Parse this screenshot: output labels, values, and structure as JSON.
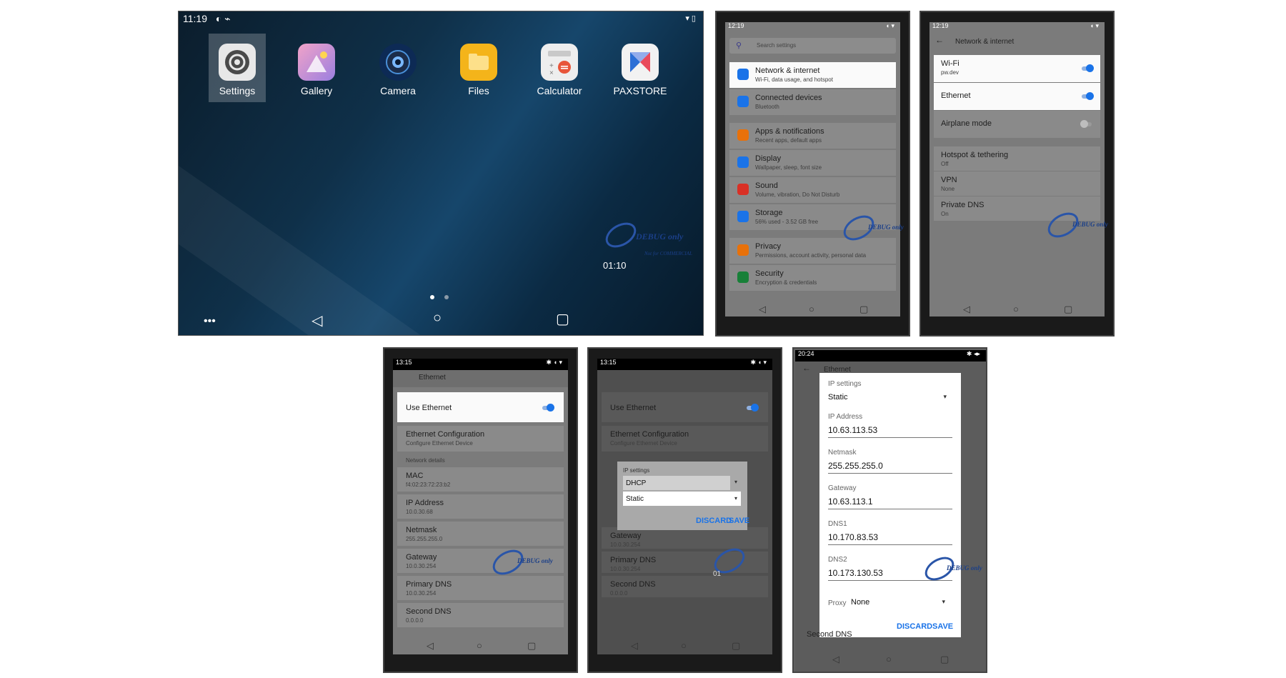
{
  "home": {
    "clock": "11:19",
    "apps": [
      {
        "label": "Settings",
        "icon": "settings-icon"
      },
      {
        "label": "Gallery",
        "icon": "gallery-icon"
      },
      {
        "label": "Camera",
        "icon": "camera-icon"
      },
      {
        "label": "Files",
        "icon": "files-icon"
      },
      {
        "label": "Calculator",
        "icon": "calculator-icon"
      },
      {
        "label": "PAXSTORE",
        "icon": "paxstore-icon"
      }
    ],
    "watermark_time": "01:10",
    "watermark_text": "DEBUG only",
    "watermark_sub": "Not for COMMERCIAL"
  },
  "settings": {
    "clock": "12:19",
    "search_placeholder": "Search settings",
    "items": [
      {
        "title": "Network & internet",
        "sub": "Wi-Fi, data usage, and hotspot",
        "color": "#1a73e8"
      },
      {
        "title": "Connected devices",
        "sub": "Bluetooth",
        "color": "#1a73e8"
      },
      {
        "title": "Apps & notifications",
        "sub": "Recent apps, default apps",
        "color": "#e8710a"
      },
      {
        "title": "Display",
        "sub": "Wallpaper, sleep, font size",
        "color": "#1a73e8"
      },
      {
        "title": "Sound",
        "sub": "Volume, vibration, Do Not Disturb",
        "color": "#d93025"
      },
      {
        "title": "Storage",
        "sub": "56% used - 3.52 GB free",
        "color": "#1a73e8"
      },
      {
        "title": "Privacy",
        "sub": "Permissions, account activity, personal data",
        "color": "#e8710a"
      },
      {
        "title": "Security",
        "sub": "Encryption & credentials",
        "color": "#188038"
      }
    ]
  },
  "network": {
    "clock": "12:19",
    "title": "Network & internet",
    "wifi": {
      "title": "Wi-Fi",
      "sub": "pw.dev"
    },
    "ethernet": {
      "title": "Ethernet"
    },
    "airplane": {
      "title": "Airplane mode"
    },
    "hotspot": {
      "title": "Hotspot & tethering",
      "sub": "Off"
    },
    "vpn": {
      "title": "VPN",
      "sub": "None"
    },
    "dns": {
      "title": "Private DNS",
      "sub": "On"
    }
  },
  "ethernet1": {
    "clock": "13:15",
    "title": "Ethernet",
    "use_ethernet": "Use Ethernet",
    "config_title": "Ethernet Configuration",
    "config_sub": "Configure Ethernet Device",
    "section": "Network details",
    "details": [
      {
        "k": "MAC",
        "v": "f4:02:23:72:23:b2"
      },
      {
        "k": "IP Address",
        "v": "10.0.30.68"
      },
      {
        "k": "Netmask",
        "v": "255.255.255.0"
      },
      {
        "k": "Gateway",
        "v": "10.0.30.254"
      },
      {
        "k": "Primary DNS",
        "v": "10.0.30.254"
      },
      {
        "k": "Second DNS",
        "v": "0.0.0.0"
      }
    ]
  },
  "ethernet2": {
    "clock": "13:15",
    "dialog_label": "IP settings",
    "options": [
      "DHCP",
      "Static"
    ],
    "discard": "DISCARD",
    "save": "SAVE",
    "watermark_time": "01"
  },
  "ethernet3": {
    "clock": "20:24",
    "title": "Ethernet",
    "ip_settings_label": "IP settings",
    "ip_settings_value": "Static",
    "fields": [
      {
        "label": "IP Address",
        "value": "10.63.113.53"
      },
      {
        "label": "Netmask",
        "value": "255.255.255.0"
      },
      {
        "label": "Gateway",
        "value": "10.63.113.1"
      },
      {
        "label": "DNS1",
        "value": "10.170.83.53"
      },
      {
        "label": "DNS2",
        "value": "10.173.130.53"
      }
    ],
    "proxy_label": "Proxy",
    "proxy_value": "None",
    "discard": "DISCARD",
    "save": "SAVE"
  }
}
